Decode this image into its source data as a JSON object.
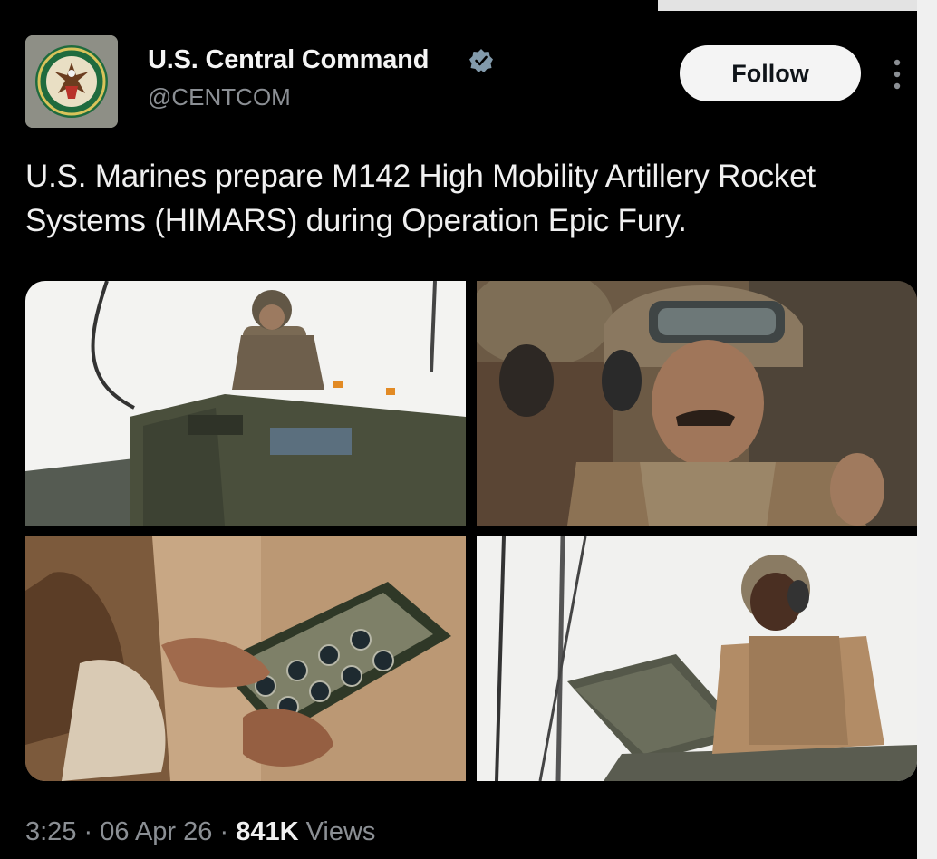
{
  "account": {
    "display_name": "U.S. Central Command",
    "handle": "@CENTCOM",
    "verified": true,
    "avatar": "centcom-seal-icon"
  },
  "actions": {
    "follow_label": "Follow",
    "more_icon": "more-vertical-icon"
  },
  "post": {
    "text": "U.S. Marines prepare M142 High Mobility Artillery Rocket Systems (HIMARS) during Operation Epic Fury."
  },
  "media": {
    "photos": [
      "marine-atop-himars-vehicle",
      "marines-in-helmets-closeup",
      "hands-holding-rocket-pod",
      "marine-on-vehicle-hatch"
    ]
  },
  "meta": {
    "time": "3:25",
    "separator": "·",
    "date": "06 Apr 26",
    "views_count": "841K",
    "views_label": "Views"
  },
  "colors": {
    "background": "#000000",
    "verified_badge": "#829aab",
    "follow_button": "#f4f4f4",
    "secondary_text": "#8b8f94"
  }
}
